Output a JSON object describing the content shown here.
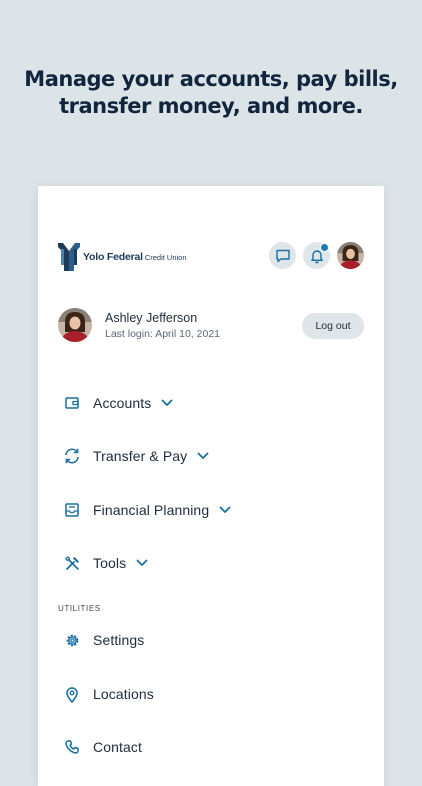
{
  "headline": {
    "line1": "Manage your accounts, pay bills,",
    "line2": "transfer money, and more."
  },
  "logo": {
    "name": "Yolo Federal",
    "subtitle": "Credit Union"
  },
  "top_actions": {
    "has_unread_notifications": true
  },
  "profile": {
    "name": "Ashley Jefferson",
    "last_login": "Last login: April 10, 2021",
    "logout_label": "Log out"
  },
  "menu": {
    "items": [
      {
        "label": "Accounts",
        "icon": "wallet-icon",
        "expandable": true
      },
      {
        "label": "Transfer & Pay",
        "icon": "transfer-icon",
        "expandable": true
      },
      {
        "label": "Financial Planning",
        "icon": "planning-icon",
        "expandable": true
      },
      {
        "label": "Tools",
        "icon": "tools-icon",
        "expandable": true
      }
    ]
  },
  "utilities": {
    "section_label": "UTILITIES",
    "items": [
      {
        "label": "Settings",
        "icon": "gear-icon"
      },
      {
        "label": "Locations",
        "icon": "location-pin-icon"
      },
      {
        "label": "Contact",
        "icon": "phone-icon"
      }
    ]
  },
  "colors": {
    "background": "#dce4e8",
    "headline": "#12253f",
    "accent": "#1a6fa0",
    "button_bg": "#dfe6ea",
    "text": "#1d2c3c"
  }
}
